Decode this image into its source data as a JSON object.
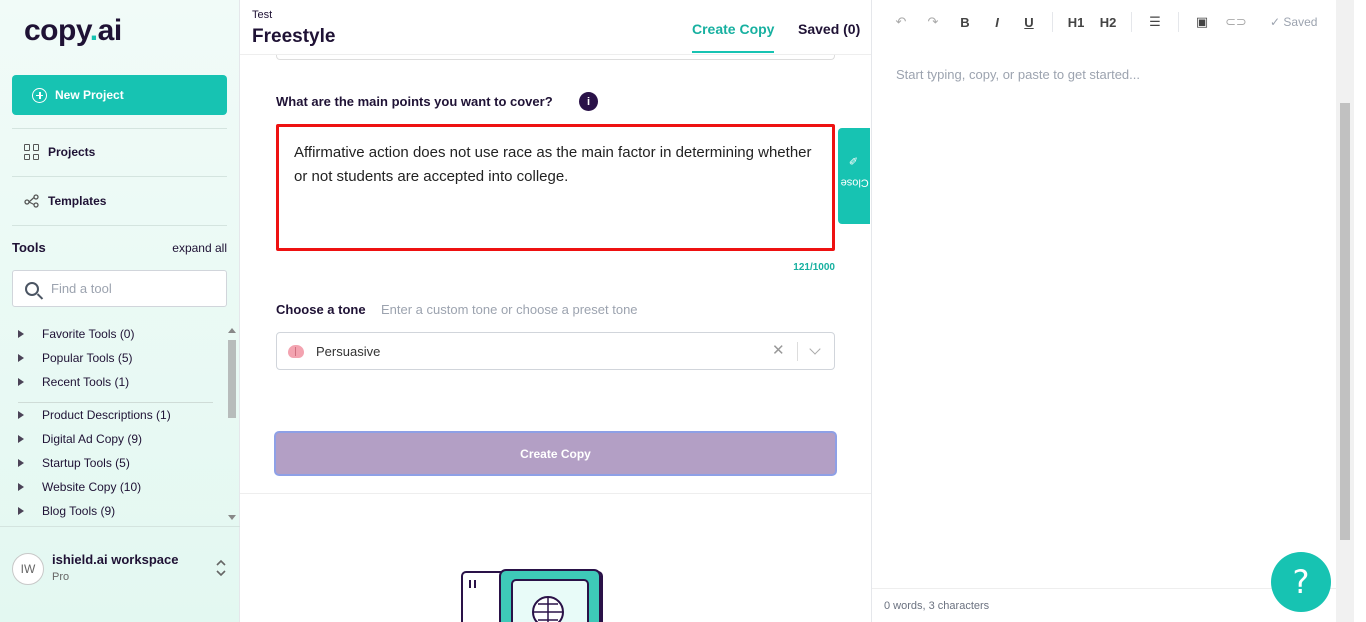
{
  "brand": {
    "name_main": "copy",
    "name_dot": ".",
    "name_tail": "ai",
    "accent": "#17c3b2"
  },
  "sidebar": {
    "new_project": "New Project",
    "nav": [
      {
        "label": "Projects",
        "icon": "grid-icon"
      },
      {
        "label": "Templates",
        "icon": "templates-icon"
      }
    ],
    "tools_title": "Tools",
    "expand_all": "expand all",
    "search_placeholder": "Find a tool",
    "tools_top": [
      "Favorite Tools (0)",
      "Popular Tools (5)",
      "Recent Tools (1)"
    ],
    "tools_bottom": [
      "Product Descriptions (1)",
      "Digital Ad Copy (9)",
      "Startup Tools (5)",
      "Website Copy (10)",
      "Blog Tools (9)"
    ],
    "workspace": {
      "initials": "IW",
      "name": "ishield.ai workspace",
      "plan": "Pro"
    }
  },
  "main": {
    "breadcrumb": "Test",
    "title": "Freestyle",
    "tabs": {
      "create": "Create Copy",
      "saved": "Saved (0)"
    },
    "question": "What are the main points you want to cover?",
    "info": "i",
    "main_points": "Affirmative action does not use race as the main factor in determining whether or not students are accepted into college.",
    "counter": "121/1000",
    "close_tab": "Close",
    "tone_label": "Choose a tone",
    "tone_hint": "Enter a custom tone or choose a preset tone",
    "tone_value": "Persuasive",
    "create_button": "Create Copy"
  },
  "editor": {
    "toolbar": {
      "bold": "B",
      "italic": "I",
      "underline": "U",
      "h1": "H1",
      "h2": "H2"
    },
    "saved": "Saved",
    "placeholder": "Start typing, copy, or paste to get started...",
    "status": "0 words, 3 characters",
    "help": "?"
  }
}
